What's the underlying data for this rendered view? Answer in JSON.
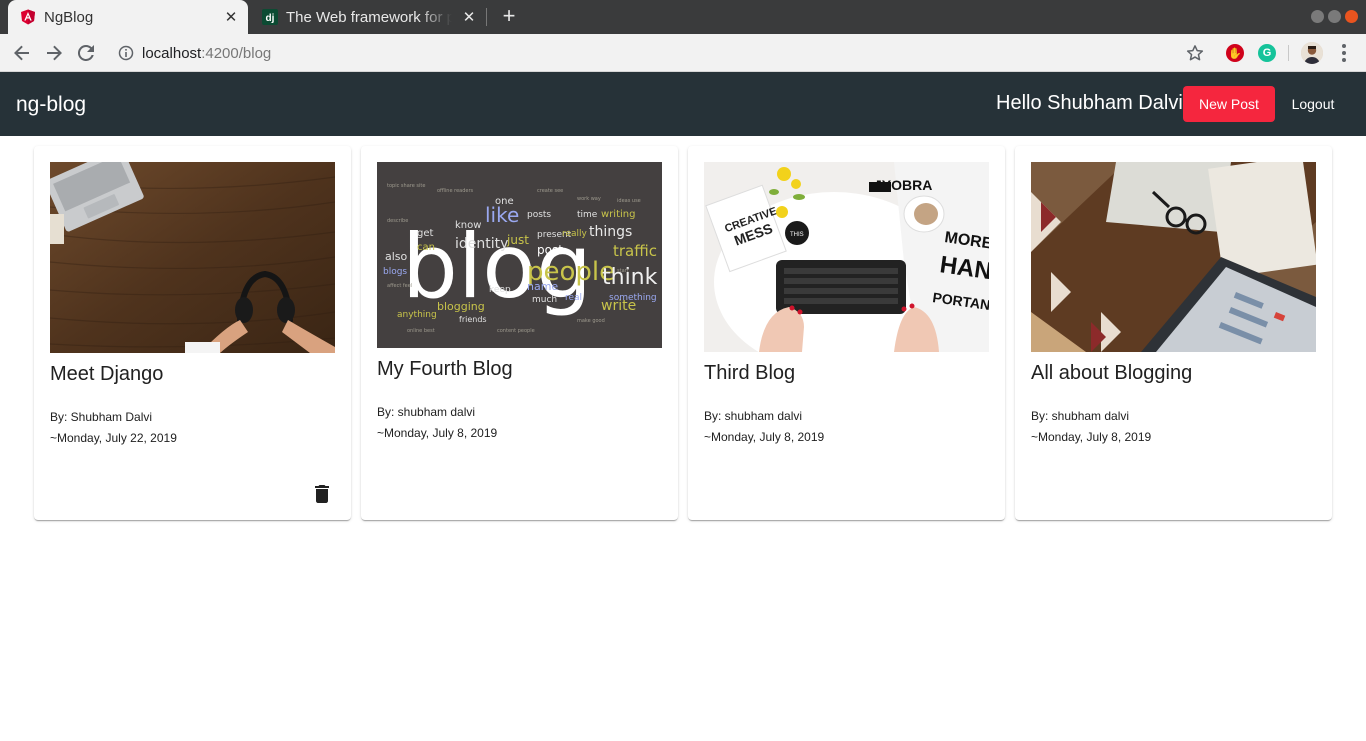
{
  "browser": {
    "tabs": [
      {
        "title": "NgBlog",
        "active": true,
        "icon": "angular-icon"
      },
      {
        "title": "The Web framework for perfectionists with deadlines | Django",
        "active": false,
        "icon": "django-icon"
      }
    ],
    "url": {
      "host": "localhost",
      "path": ":4200/blog"
    }
  },
  "app": {
    "title": "ng-blog",
    "greeting": "Hello Shubham Dalvi",
    "new_post_label": "New Post",
    "logout_label": "Logout",
    "colors": {
      "header_bg": "#263238",
      "accent": "#f5263e"
    }
  },
  "posts": [
    {
      "title": "Meet Django",
      "author": "By: Shubham Dalvi",
      "date": "~Monday, July 22, 2019",
      "image": "desk-laptop-headphones-image",
      "deletable": true
    },
    {
      "title": "My Fourth Blog",
      "author": "By: shubham dalvi",
      "date": "~Monday, July 8, 2019",
      "image": "blog-word-cloud-image",
      "deletable": false
    },
    {
      "title": "Third Blog",
      "author": "By: shubham dalvi",
      "date": "~Monday, July 8, 2019",
      "image": "keyboard-desk-image",
      "deletable": false
    },
    {
      "title": "All about Blogging",
      "author": "By: shubham dalvi",
      "date": "~Monday, July 8, 2019",
      "image": "laptop-rug-glasses-image",
      "deletable": false
    }
  ]
}
